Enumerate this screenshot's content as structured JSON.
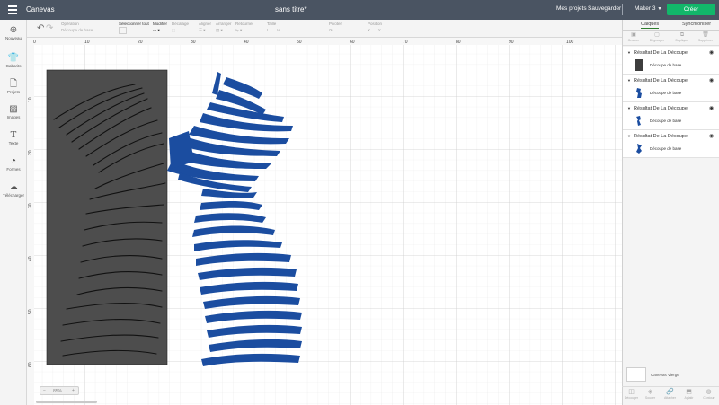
{
  "app": {
    "name": "Canevas",
    "document_title": "sans titre*"
  },
  "header": {
    "my_projects": "Mes projets",
    "save": "Sauvegarder",
    "machine": "Maker 3",
    "make": "Créer"
  },
  "toolbar": {
    "operation_label": "Opération",
    "operation_value": "Découpe de base",
    "selection_label": "Sélectionner tout",
    "edit_label": "Modifier",
    "offset_label": "Décalage",
    "align_label": "Aligner",
    "arrange_label": "Arranger",
    "flip_label": "Retourner",
    "size_label": "Taille",
    "rotate_label": "Pivoter",
    "position_label": "Position"
  },
  "leftnav": {
    "items": [
      {
        "label": "Nouveau",
        "icon": "plus-icon"
      },
      {
        "label": "Gabarits",
        "icon": "shirt-icon"
      },
      {
        "label": "Projets",
        "icon": "file-icon"
      },
      {
        "label": "Images",
        "icon": "image-icon"
      },
      {
        "label": "Texte",
        "icon": "text-icon"
      },
      {
        "label": "Formes",
        "icon": "shapes-icon"
      },
      {
        "label": "Télécharger",
        "icon": "upload-cloud-icon"
      }
    ]
  },
  "ruler": {
    "top": [
      "0",
      "10",
      "20",
      "30",
      "40",
      "50",
      "60",
      "70",
      "80",
      "90",
      "100"
    ],
    "left": [
      "10",
      "20",
      "30",
      "40",
      "50",
      "60"
    ]
  },
  "layers_panel": {
    "tabs": [
      "Calques",
      "Synchroniser"
    ],
    "tools": [
      "Grouper",
      "Dégrouper",
      "Dupliquer",
      "Supprimer"
    ],
    "groups": [
      {
        "title": "Résultat De La Découpe",
        "child": "Découpe de base",
        "thumb": "dark"
      },
      {
        "title": "Résultat De La Découpe",
        "child": "Découpe de base",
        "thumb": "blue"
      },
      {
        "title": "Résultat De La Découpe",
        "child": "Découpe de base",
        "thumb": "blue"
      },
      {
        "title": "Résultat De La Découpe",
        "child": "Découpe de base",
        "thumb": "blue"
      }
    ],
    "blank_canvas": "Canevas Vierge",
    "bottom_tools": [
      "Découper",
      "Souder",
      "Attacher",
      "Aplatir",
      "Contour"
    ]
  },
  "zoom": {
    "value": "85%"
  },
  "colors": {
    "header_bg": "#4a5462",
    "make_button": "#12b76a",
    "stripe_blue": "#1b4da0",
    "dark_panel": "#4d4d4d"
  }
}
